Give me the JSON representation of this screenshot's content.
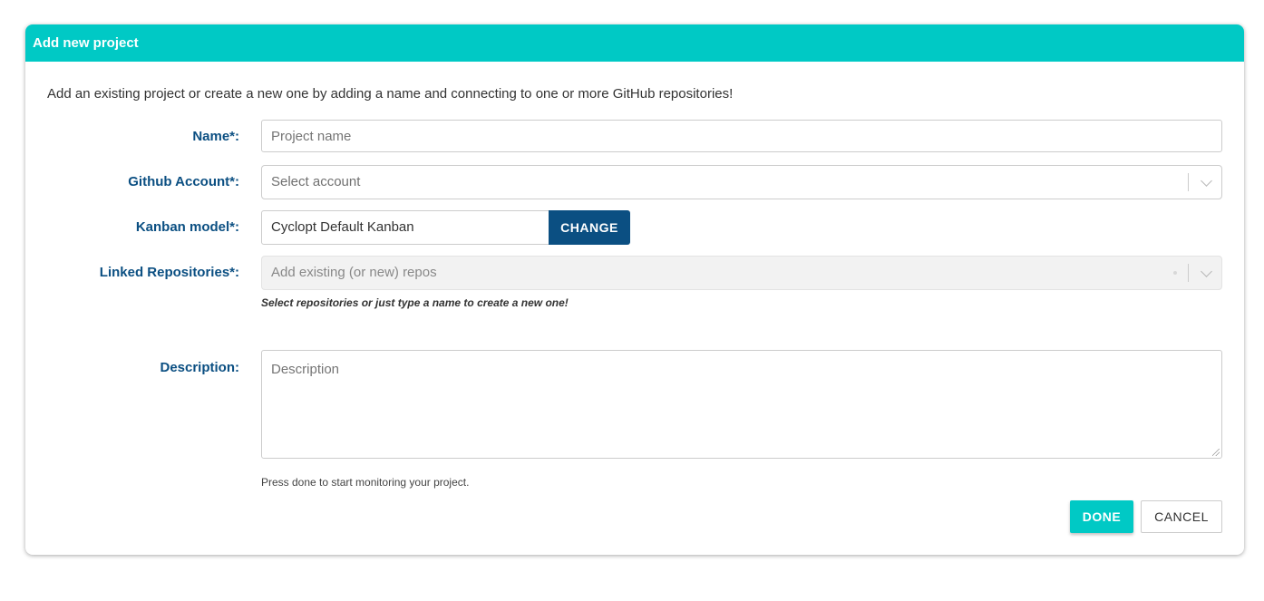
{
  "dialog": {
    "title": "Add new project",
    "intro": "Add an existing project or create a new one by adding a name and connecting to one or more GitHub repositories!"
  },
  "form": {
    "name": {
      "label": "Name*:",
      "placeholder": "Project name"
    },
    "github_account": {
      "label": "Github Account*:",
      "placeholder": "Select account"
    },
    "kanban_model": {
      "label": "Kanban model*:",
      "value": "Cyclopt Default Kanban",
      "change_label": "CHANGE"
    },
    "linked_repositories": {
      "label": "Linked Repositories*:",
      "placeholder": "Add existing (or new) repos",
      "hint": "Select repositories or just type a name to create a new one!"
    },
    "description": {
      "label": "Description:",
      "placeholder": "Description"
    }
  },
  "footer": {
    "hint": "Press done to start monitoring your project.",
    "done_label": "DONE",
    "cancel_label": "CANCEL"
  },
  "colors": {
    "header": "#00c9c5",
    "label": "#0b4f82",
    "change_button": "#0b4f82",
    "done_button": "#00c9c5"
  }
}
